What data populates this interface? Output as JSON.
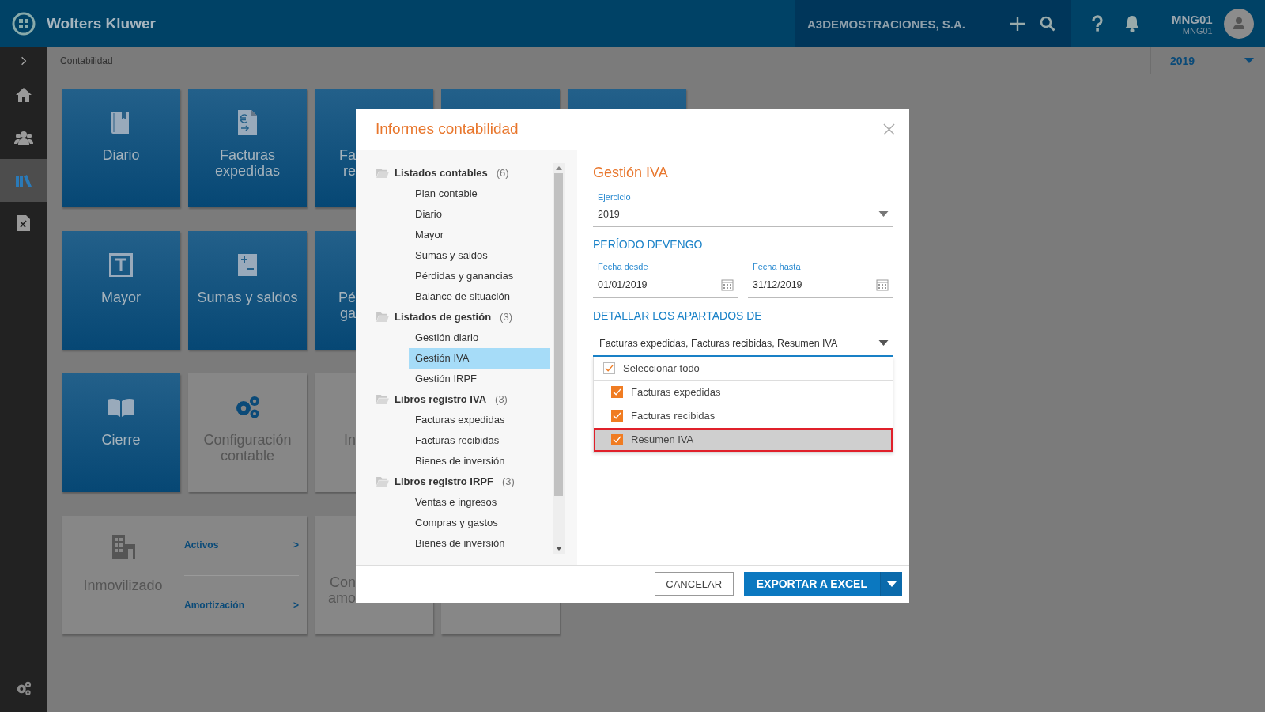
{
  "header": {
    "brand": "Wolters Kluwer",
    "company": "A3DEMOSTRACIONES, S.A.",
    "user": "MNG01",
    "user_sub": "MNG01"
  },
  "sidebar": {
    "items": [
      {
        "kind": "home",
        "selected": false
      },
      {
        "kind": "people",
        "selected": false
      },
      {
        "kind": "books",
        "selected": true
      },
      {
        "kind": "document",
        "selected": false
      }
    ]
  },
  "breadcrumb": "Contabilidad",
  "year": "2019",
  "tile_rows": [
    [
      {
        "kind": "blue",
        "lines": [
          "Diario"
        ]
      },
      {
        "kind": "blue",
        "lines": [
          "Facturas",
          "expedidas"
        ]
      },
      {
        "kind": "blue",
        "lines": [
          "Fa",
          "re"
        ],
        "clipped": true
      },
      {
        "kind": "blue"
      },
      {
        "kind": "blue"
      }
    ],
    [
      {
        "kind": "blue",
        "lines": [
          "Mayor"
        ]
      },
      {
        "kind": "blue",
        "lines": [
          "Sumas y saldos"
        ]
      },
      {
        "kind": "blue",
        "lines": [
          "Pé",
          "ga"
        ],
        "clipped": true
      }
    ],
    [
      {
        "kind": "blue",
        "lines": [
          "Cierre"
        ]
      },
      {
        "kind": "gray",
        "lines": [
          "Configuración",
          "contable"
        ]
      },
      {
        "kind": "gray",
        "lines": [
          "In"
        ],
        "clipped": true
      }
    ],
    [
      {
        "kind": "assets",
        "lines": [
          "Inmovilizado"
        ],
        "links": [
          "Activos",
          "Amortización"
        ],
        "link_mark": ">"
      },
      {
        "kind": "gray",
        "lines": [
          "Con",
          "amo"
        ],
        "clipped": true
      },
      {
        "kind": "gray"
      }
    ]
  ],
  "dialog": {
    "title": "Informes contabilidad",
    "tree": [
      {
        "label": "Listados contables",
        "count": "(6)",
        "children": [
          {
            "label": "Plan contable",
            "selected": false
          },
          {
            "label": "Diario",
            "selected": false
          },
          {
            "label": "Mayor",
            "selected": false
          },
          {
            "label": "Sumas y saldos",
            "selected": false
          },
          {
            "label": "Pérdidas y ganancias",
            "selected": false
          },
          {
            "label": "Balance de situación",
            "selected": false
          }
        ]
      },
      {
        "label": "Listados de gestión",
        "count": "(3)",
        "children": [
          {
            "label": "Gestión diario",
            "selected": false
          },
          {
            "label": "Gestión IVA",
            "selected": true
          },
          {
            "label": "Gestión IRPF",
            "selected": false
          }
        ]
      },
      {
        "label": "Libros registro IVA",
        "count": "(3)",
        "children": [
          {
            "label": "Facturas expedidas",
            "selected": false
          },
          {
            "label": "Facturas recibidas",
            "selected": false
          },
          {
            "label": "Bienes de inversión",
            "selected": false
          }
        ]
      },
      {
        "label": "Libros registro IRPF",
        "count": "(3)",
        "children": [
          {
            "label": "Ventas e ingresos",
            "selected": false
          },
          {
            "label": "Compras y gastos",
            "selected": false
          },
          {
            "label": "Bienes de inversión",
            "selected": false
          }
        ]
      }
    ],
    "panel": {
      "title": "Gestión IVA",
      "ejercicio": {
        "label": "Ejercicio",
        "value": "2019"
      },
      "period_heading": "PERÍODO DEVENGO",
      "dates": [
        {
          "label": "Fecha desde",
          "value": "01/01/2019"
        },
        {
          "label": "Fecha hasta",
          "value": "31/12/2019"
        }
      ],
      "detail_heading": "DETALLAR LOS APARTADOS DE",
      "multiselect": {
        "value": "Facturas expedidas, Facturas recibidas, Resumen IVA",
        "options": [
          {
            "kind": "all",
            "label": "Seleccionar todo",
            "checked": true,
            "highlighted": false
          },
          {
            "kind": "item",
            "label": "Facturas expedidas",
            "checked": true,
            "highlighted": false
          },
          {
            "kind": "item",
            "label": "Facturas recibidas",
            "checked": true,
            "highlighted": false
          },
          {
            "kind": "item",
            "label": "Resumen IVA",
            "checked": true,
            "highlighted": true
          }
        ]
      }
    },
    "buttons": {
      "cancel": "CANCELAR",
      "export": "EXPORTAR A EXCEL"
    }
  }
}
